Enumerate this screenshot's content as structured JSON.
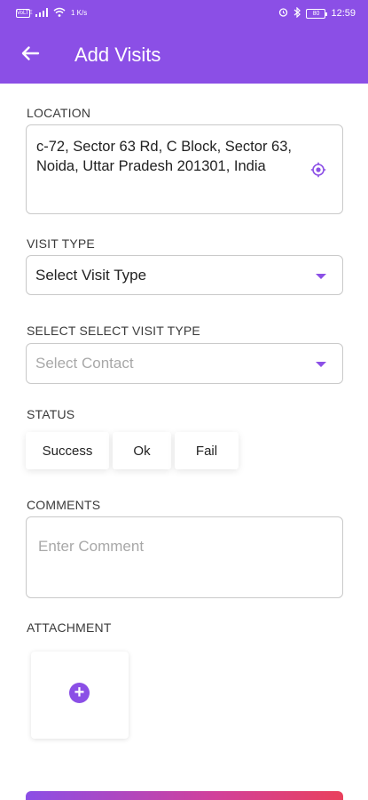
{
  "status_bar": {
    "left_badge": "VoLTE",
    "net_speed": "1 K/s",
    "battery": "80",
    "time": "12:59"
  },
  "app_bar": {
    "title": "Add Visits",
    "back_icon": "arrow-left-icon"
  },
  "location": {
    "label": "LOCATION",
    "value": "c-72, Sector 63 Rd, C Block, Sector 63, Noida, Uttar Pradesh 201301, India",
    "icon": "gps-target-icon"
  },
  "visit_type": {
    "label": "VISIT TYPE",
    "value": "Select Visit Type"
  },
  "contact": {
    "label": "SELECT SELECT VISIT TYPE",
    "placeholder": "Select Contact"
  },
  "status": {
    "label": "STATUS",
    "options": [
      "Success",
      "Ok",
      "Fail"
    ]
  },
  "comments": {
    "label": "COMMENTS",
    "placeholder": "Enter Comment"
  },
  "attachment": {
    "label": "ATTACHMENT",
    "icon": "plus-circle-icon"
  },
  "colors": {
    "primary": "#8b4fe6",
    "gradient_end": "#e9405c"
  }
}
